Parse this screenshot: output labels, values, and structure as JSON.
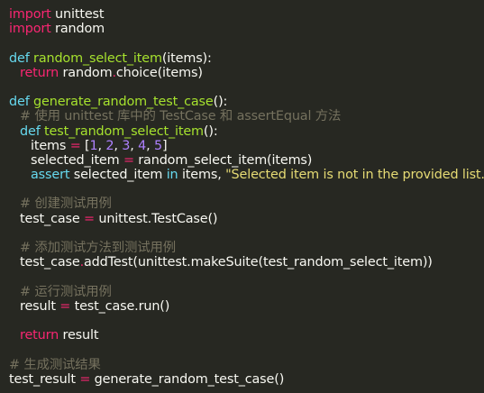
{
  "code": {
    "l1": {
      "kw": "import",
      "rest": " unittest"
    },
    "l2": {
      "kw": "import",
      "rest": " random"
    },
    "l4": {
      "kw": "def",
      "fn": "random_select_item",
      "rest": "(items):"
    },
    "l5": {
      "kw": "return",
      "a": " random",
      "op": ".",
      "b": "choice(items)"
    },
    "l7": {
      "kw": "def",
      "fn": "generate_random_test_case",
      "rest": "():"
    },
    "l8": {
      "comment": "# 使用 unittest 库中的 TestCase 和 assertEqual 方法"
    },
    "l9": {
      "kw": "def",
      "fn": "test_random_select_item",
      "rest": "():"
    },
    "l10": {
      "a": "items ",
      "op": "=",
      "b": " [",
      "n1": "1",
      "c1": ", ",
      "n2": "2",
      "c2": ", ",
      "n3": "3",
      "c3": ", ",
      "n4": "4",
      "c4": ", ",
      "n5": "5",
      "end": "]"
    },
    "l11": {
      "a": "selected_item ",
      "op": "=",
      "b": " random_select_item(items)"
    },
    "l12": {
      "kw": "assert",
      "a": " selected_item ",
      "kw2": "in",
      "b": " items, ",
      "str": "\"Selected item is not in the provided list.\""
    },
    "l14": {
      "comment": "# 创建测试用例"
    },
    "l15": {
      "a": "test_case ",
      "op": "=",
      "b": " unittest.TestCase()"
    },
    "l17": {
      "comment": "# 添加测试方法到测试用例"
    },
    "l18": {
      "a": "test_case",
      "op": ".",
      "b": "addTest(unittest.makeSuite(test_random_select_item))"
    },
    "l20": {
      "comment": "# 运行测试用例"
    },
    "l21": {
      "a": "result ",
      "op": "=",
      "b": " test_case.run()"
    },
    "l23": {
      "kw": "return",
      "rest": " result"
    },
    "l25": {
      "comment": "# 生成测试结果"
    },
    "l26": {
      "a": "test_result ",
      "op": "=",
      "b": " generate_random_test_case()"
    }
  },
  "colors": {
    "background": "#272822",
    "keyword": "#f92672",
    "function_name": "#a6e22e",
    "number": "#ae81ff",
    "string": "#e6db74",
    "comment": "#75715e",
    "text": "#f8f8f2"
  }
}
